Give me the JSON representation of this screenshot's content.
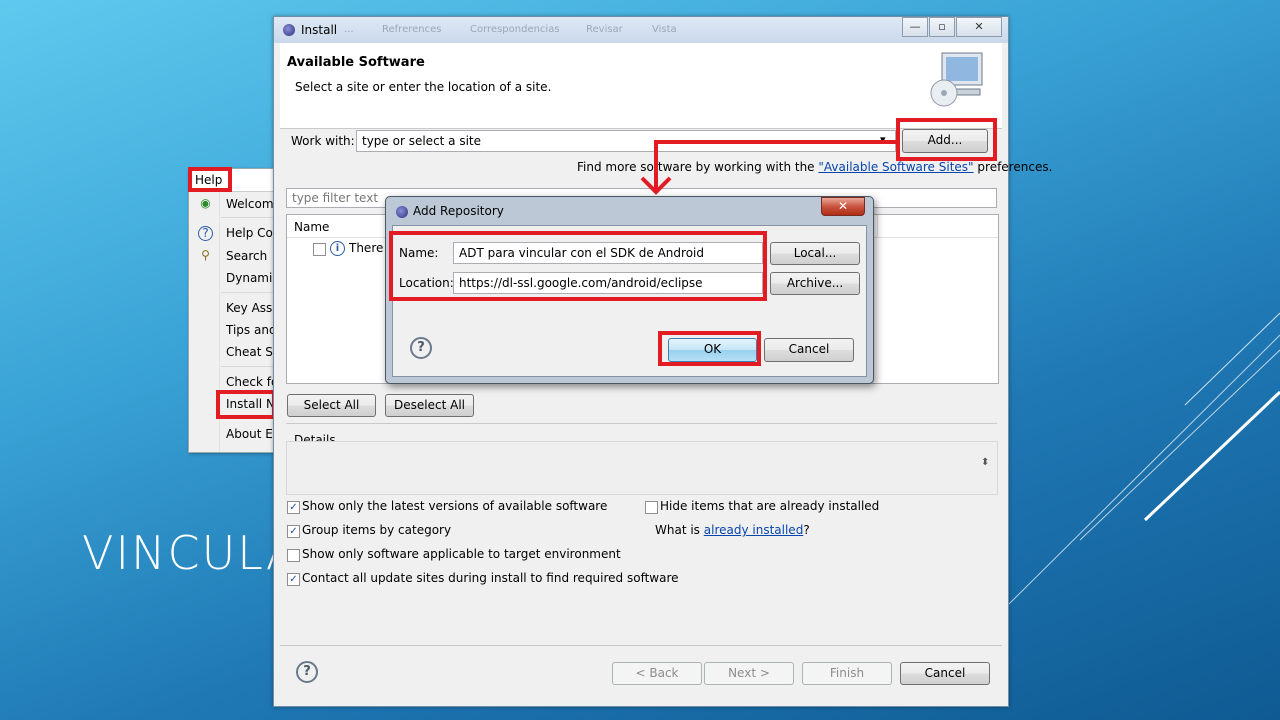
{
  "slide": {
    "title_partial": "VINCULA"
  },
  "help_menu": {
    "menu_title": "Help",
    "items": [
      "Welcome",
      "Help Con",
      "Search",
      "Dynamic",
      "Key Assis",
      "Tips and",
      "Cheat Sh",
      "Check fo",
      "Install Ne",
      "About Ec"
    ]
  },
  "install": {
    "window_title": "Install",
    "background_tabs": [
      "...",
      "Refrerences",
      "Correspondencias",
      "Revisar",
      "Vista"
    ],
    "header_title": "Available Software",
    "header_subtitle": "Select a site or enter the location of a site.",
    "work_with_label": "Work with:",
    "work_with_value": "type or select a site",
    "add_button": "Add...",
    "find_more_prefix": "Find more software by working with the",
    "find_more_link": "\"Available Software Sites\"",
    "find_more_suffix": "preferences.",
    "filter_placeholder": "type filter text",
    "column_name": "Name",
    "list_row_text": "There i",
    "select_all": "Select All",
    "deselect_all": "Deselect All",
    "details_label": "Details",
    "options": {
      "show_latest": {
        "label": "Show only the latest versions of available software",
        "checked": true
      },
      "group_by_category": {
        "label": "Group items by category",
        "checked": true
      },
      "applicable_only": {
        "label": "Show only software applicable to target environment",
        "checked": false
      },
      "contact_sites": {
        "label": "Contact all update sites during install to find required software",
        "checked": true
      },
      "hide_installed": {
        "label": "Hide items that are already installed",
        "checked": false
      }
    },
    "what_is_prefix": "What is",
    "what_is_link": "already installed",
    "what_is_suffix": "?",
    "back_button": "< Back",
    "next_button": "Next >",
    "finish_button": "Finish",
    "cancel_button": "Cancel"
  },
  "add_repository": {
    "title": "Add Repository",
    "name_label": "Name:",
    "name_value": "ADT para vincular con el SDK de Android",
    "location_label": "Location:",
    "location_value": "https://dl-ssl.google.com/android/eclipse",
    "local_button": "Local...",
    "archive_button": "Archive...",
    "ok_button": "OK",
    "cancel_button": "Cancel",
    "close_glyph": "✕"
  },
  "glyphs": {
    "minimize": "—",
    "maximize": "▫",
    "close": "✕",
    "dropdown": "▾",
    "check": "✓",
    "question": "?",
    "info": "i"
  },
  "colors": {
    "highlight": "#e31b23",
    "link": "#0645ad"
  }
}
